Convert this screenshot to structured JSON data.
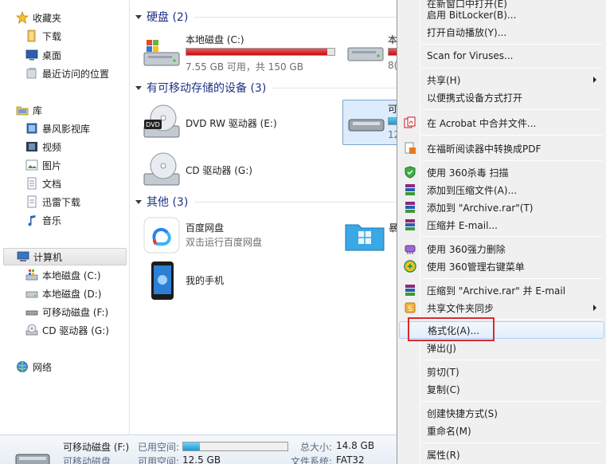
{
  "nav": {
    "favorites": "收藏夹",
    "downloads": "下载",
    "desktop": "桌面",
    "recent": "最近访问的位置",
    "libraries": "库",
    "storm": "暴风影视库",
    "videos": "视频",
    "pictures": "图片",
    "documents": "文档",
    "thunder": "迅雷下载",
    "music": "音乐",
    "computer": "计算机",
    "drive_c": "本地磁盘 (C:)",
    "drive_d": "本地磁盘 (D:)",
    "drive_f": "可移动磁盘 (F:)",
    "drive_g": "CD 驱动器 (G:)",
    "network": "网络"
  },
  "content": {
    "hdd_header": "硬盘 (2)",
    "removable_header": "有可移动存储的设备 (3)",
    "other_header": "其他 (3)",
    "drive_c_name": "本地磁盘 (C:)",
    "drive_c_space": "7.55 GB 可用，共 150 GB",
    "drive_c_fill": 0.95,
    "drive_d_partial": "本",
    "drive_d_partial_space": "8(",
    "drive_d_fill": 0.9,
    "dvd_name": "DVD RW 驱动器 (E:)",
    "cd_name": "CD 驱动器 (G:)",
    "removable_partial": "可",
    "removable_partial_sub": "12",
    "baidu_name": "百度网盘",
    "baidu_sub": "双击运行百度网盘",
    "storm_partial": "暴",
    "phone_name": "我的手机"
  },
  "details": {
    "name": "可移动磁盘 (F:)",
    "type": "可移动磁盘",
    "used_label": "已用空间:",
    "free_label": "可用空间:",
    "free_value": "12.5 GB",
    "total_label": "总大小:",
    "total_value": "14.8 GB",
    "fs_label": "文件系统:",
    "fs_value": "FAT32",
    "used_fill": 0.16
  },
  "menu": {
    "open_new_window": "在新窗口中打开(E)",
    "bitlocker": "启用 BitLocker(B)...",
    "autoplay": "打开自动播放(Y)...",
    "scan": "Scan for Viruses...",
    "share": "共享(H)",
    "portable_open": "以便携式设备方式打开",
    "acrobat": "在 Acrobat 中合并文件...",
    "foxit": "在福昕阅读器中转换成PDF",
    "scan360": "使用 360杀毒 扫描",
    "add_archive": "添加到压缩文件(A)...",
    "add_rar": "添加到 \"Archive.rar\"(T)",
    "compress_email": "压缩并 E-mail...",
    "del360": "使用 360强力删除",
    "manage360": "使用 360管理右键菜单",
    "compress_rar_email": "压缩到 \"Archive.rar\" 并 E-mail",
    "share_sync": "共享文件夹同步",
    "format": "格式化(A)...",
    "eject": "弹出(J)",
    "cut": "剪切(T)",
    "copy": "复制(C)",
    "shortcut": "创建快捷方式(S)",
    "rename": "重命名(M)",
    "properties": "属性(R)"
  },
  "colors": {
    "group_header": "#1e3287",
    "drive_full_bar": "#d9141e",
    "used_bar": "#27a9e3",
    "highlight_box": "#e0282d"
  }
}
